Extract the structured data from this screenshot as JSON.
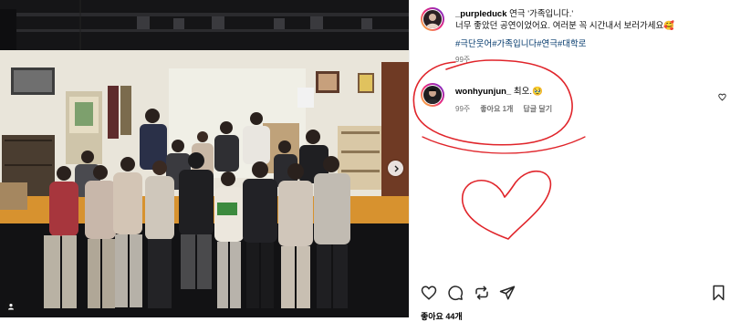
{
  "post": {
    "username": "_purpleduck",
    "title": "연극 '가족입니다.'",
    "caption": "너무 좋았던 공연이었어요. 여러분 꼭 시간내서 보러가세요🥰",
    "hashtags": [
      "#극단웃어",
      "#가족입니다",
      "#연극",
      "#대학로"
    ],
    "time_ago": "99주"
  },
  "comment": {
    "username": "wonhyunjun_",
    "text": "최오.🥹",
    "time_ago": "99주",
    "likes": "좋아요 1개",
    "reply_label": "답글 달기"
  },
  "likes_total": "좋아요 44개",
  "icons": {
    "like": "heart-icon",
    "comment": "comment-icon",
    "share": "share-icon",
    "repost": "repost-icon",
    "save": "bookmark-icon",
    "next": "chevron-right-icon",
    "tag": "user-tag-icon"
  },
  "annotation_color": "#e0242a",
  "accent_color": "#00376b"
}
